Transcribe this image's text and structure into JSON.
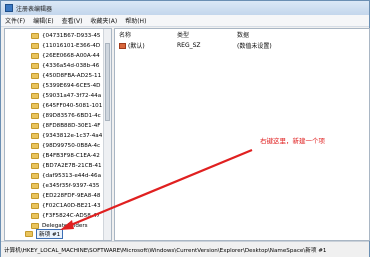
{
  "window": {
    "title": "注册表编辑器"
  },
  "menu": [
    "文件(F)",
    "编辑(E)",
    "查看(V)",
    "收藏夹(A)",
    "帮助(H)"
  ],
  "tree": {
    "items": [
      "{04731B67-D933-45",
      "{11016101-E366-4D",
      "{26EE0668-A00A-44",
      "{4336a54d-038b-46",
      "{450D8FBA-AD25-11",
      "{5399E694-6CE5-4D",
      "{59031a47-3f72-44a",
      "{645FF040-5081-101",
      "{89D83576-6BD1-4c",
      "{8FD8B88D-30E1-4F",
      "{9343812e-1c37-4a4",
      "{98D99750-0B8A-4c",
      "{B4FB3F98-C1EA-42",
      "{BD7A2E7B-21CB-41",
      "{daf95313-e44d-46a",
      "{e345f35f-9397-435",
      "{ED228FDF-9EA8-48",
      "{F02C1A0D-BE21-43",
      "{F3F5824C-AD58-47",
      "DelegateFolders"
    ],
    "selected": "新项 #1"
  },
  "values": {
    "headers": {
      "name": "名称",
      "type": "类型",
      "data": "数据"
    },
    "rows": [
      {
        "name": "(默认)",
        "type": "REG_SZ",
        "data": "(数值未设置)"
      }
    ]
  },
  "annotation": "右键这里，新建一个项",
  "status": "计算机\\HKEY_LOCAL_MACHINE\\SOFTWARE\\Microsoft\\Windows\\CurrentVersion\\Explorer\\Desktop\\NameSpace\\新项 #1",
  "colors": {
    "arrow": "#e02020",
    "selection": "#3d6fb5"
  }
}
